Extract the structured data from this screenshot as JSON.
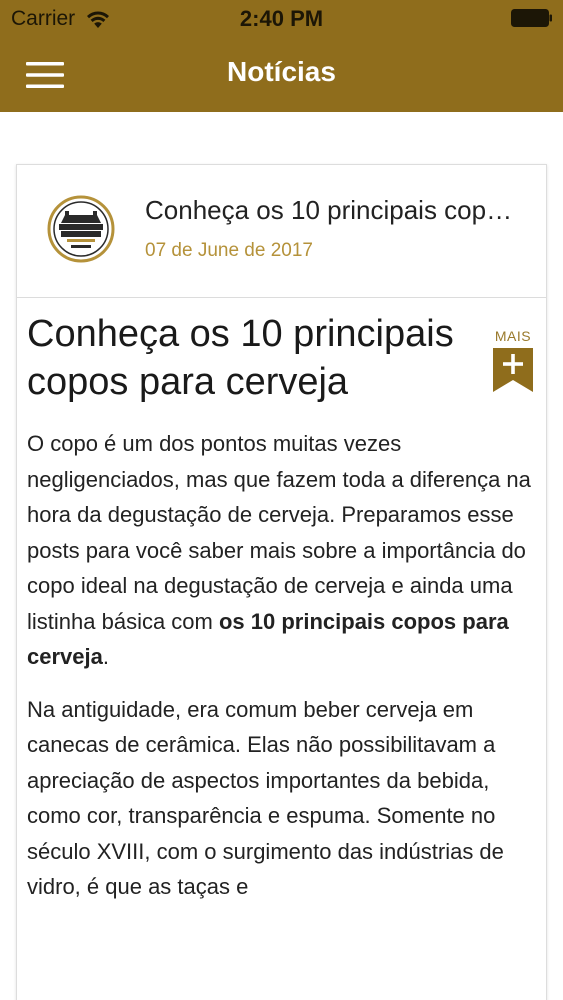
{
  "status_bar": {
    "carrier": "Carrier",
    "time": "2:40 PM"
  },
  "nav": {
    "title": "Notícias",
    "menu_icon": "hamburger-menu-icon"
  },
  "colors": {
    "brand": "#8f6d1c",
    "date": "#b5923a",
    "text": "#222222"
  },
  "card": {
    "logo_icon": "cidade-imperial-logo",
    "title": "Conheça os 10 principais copos para cerveja",
    "date": "07 de June de 2017",
    "more_label": "MAIS",
    "more_icon": "plus-bookmark-icon",
    "article_title": "Conheça os 10 principais copos para cerveja",
    "paragraph1": {
      "text": "O copo é um dos pontos muitas vezes negligenciados, mas que fazem toda a diferença na hora da degustação de cerveja. Preparamos esse posts para você saber mais sobre a importância do copo ideal na degustação de cerveja e ainda uma listinha básica com ",
      "bold": "os 10 principais copos para cerveja",
      "end": "."
    },
    "paragraph2": "Na antiguidade, era comum beber cerveja em canecas de cerâmica. Elas não possibilitavam a apreciação de aspectos importantes da bebida, como cor, transparência e espuma. Somente no século XVIII, com o surgimento das indústrias de vidro, é que as taças e"
  }
}
